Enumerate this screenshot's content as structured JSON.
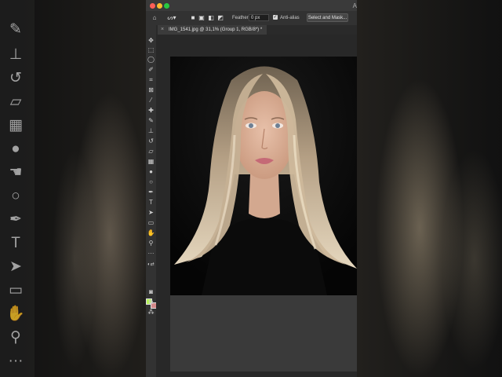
{
  "window": {
    "title_fragment": "A"
  },
  "options_bar": {
    "feather_label": "Feather:",
    "feather_value": "0 px",
    "anti_alias_label": "Anti-alias",
    "anti_alias_checked": true,
    "select_mask_label": "Select and Mask..."
  },
  "document_tab": {
    "label": "IMG_1541.jpg @ 31,1% (Group 1, RGB/8*) *",
    "close": "×"
  },
  "colors": {
    "foreground": "#b5f25a",
    "background": "#d4898a"
  },
  "tools": [
    "move-tool",
    "marquee-tool",
    "lasso-tool",
    "quick-select-tool",
    "crop-tool",
    "frame-tool",
    "eyedropper-tool",
    "healing-brush-tool",
    "brush-tool",
    "clone-stamp-tool",
    "history-brush-tool",
    "eraser-tool",
    "gradient-tool",
    "blur-tool",
    "dodge-tool",
    "pen-tool",
    "type-tool",
    "path-select-tool",
    "rectangle-tool",
    "hand-tool",
    "zoom-tool",
    "more-tools"
  ]
}
